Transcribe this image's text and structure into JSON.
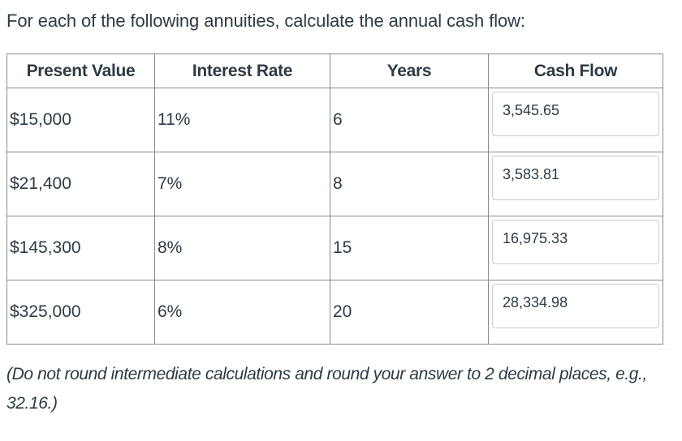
{
  "question": {
    "prompt": "For each of the following annuities, calculate the annual cash flow:",
    "note": "(Do not round intermediate calculations and round your answer to 2 decimal places, e.g., 32.16.)"
  },
  "table": {
    "headers": [
      "Present Value",
      "Interest Rate",
      "Years",
      "Cash Flow"
    ],
    "rows": [
      {
        "present_value": "$15,000",
        "interest_rate": "11%",
        "years": "6",
        "cash_flow": "3,545.65"
      },
      {
        "present_value": "$21,400",
        "interest_rate": "7%",
        "years": "8",
        "cash_flow": "3,583.81"
      },
      {
        "present_value": "$145,300",
        "interest_rate": "8%",
        "years": "15",
        "cash_flow": "16,975.33"
      },
      {
        "present_value": "$325,000",
        "interest_rate": "6%",
        "years": "20",
        "cash_flow": "28,334.98"
      }
    ]
  },
  "colors": {
    "text": "#2d3b45",
    "outer_border": "#3a3a3a",
    "inner_border": "#8a8a8a",
    "input_border": "#c7cdd1"
  }
}
